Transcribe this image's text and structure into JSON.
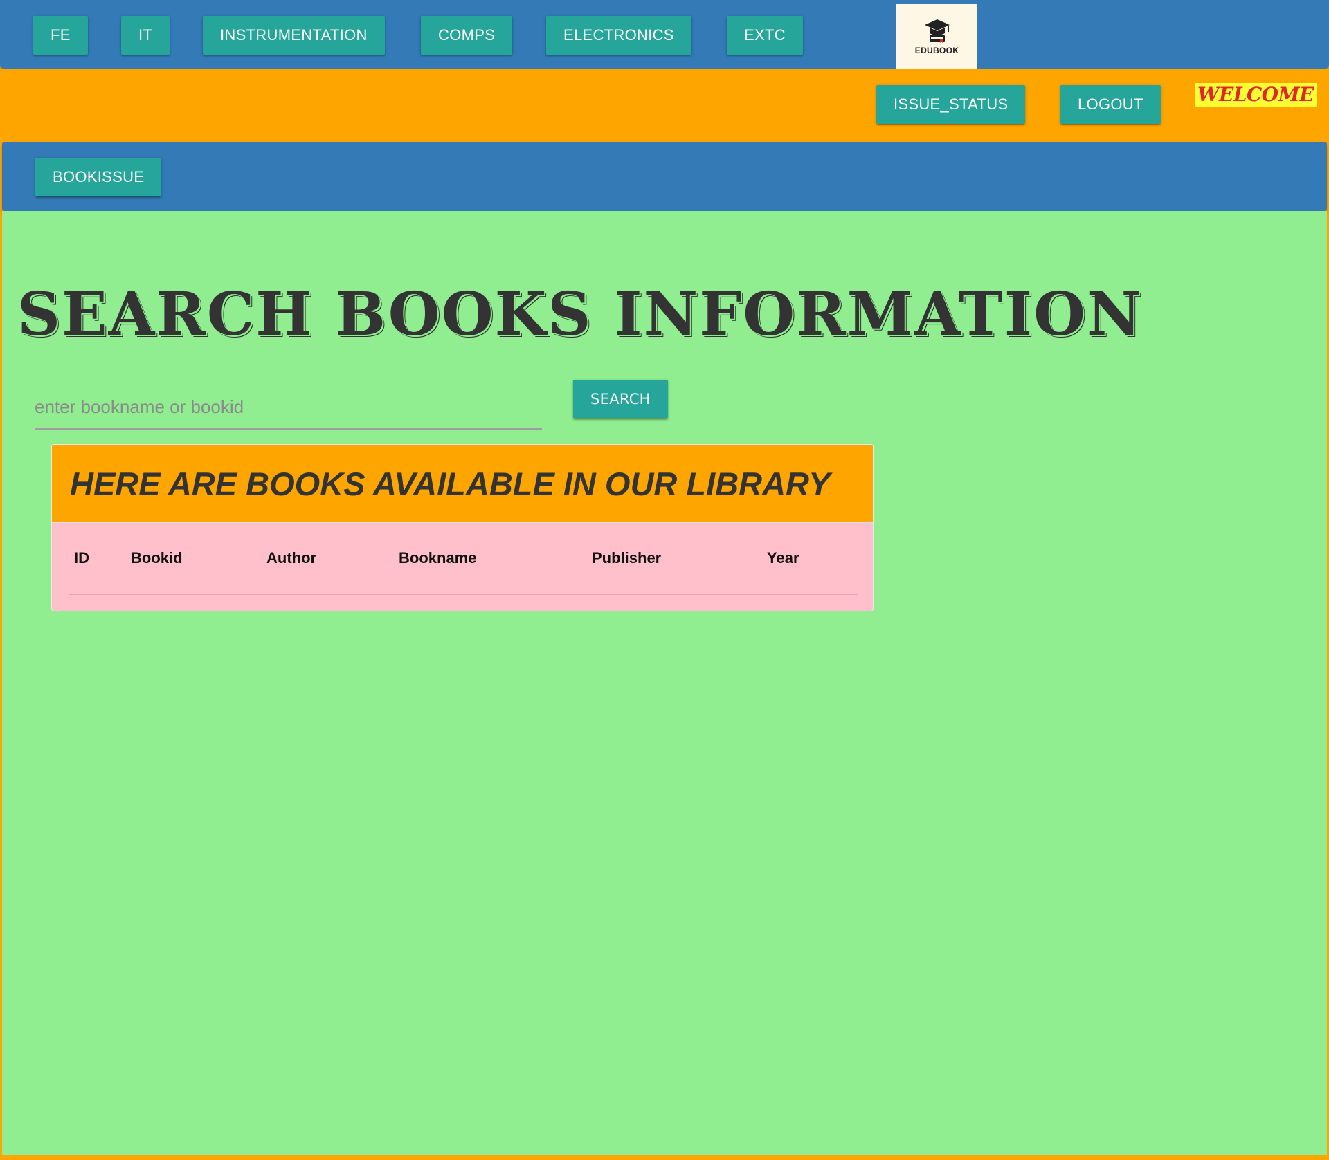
{
  "top_nav": {
    "items": [
      {
        "label": "FE"
      },
      {
        "label": "IT"
      },
      {
        "label": "INSTRUMENTATION"
      },
      {
        "label": "COMPS"
      },
      {
        "label": "ELECTRONICS"
      },
      {
        "label": "EXTC"
      }
    ],
    "logo": {
      "text": "EDUBOOK",
      "icon": "graduation-cap-book-icon"
    }
  },
  "user_bar": {
    "issue_status_label": "ISSUE_STATUS",
    "logout_label": "LOGOUT",
    "welcome_text": "WELCOME"
  },
  "secondary_nav": {
    "bookissue_label": "BOOKISSUE"
  },
  "main": {
    "title": "SEARCH BOOKS INFORMATION",
    "search": {
      "placeholder": "enter bookname or bookid",
      "value": "",
      "button_label": "SEARCH"
    },
    "library_card": {
      "heading": "HERE ARE BOOKS AVAILABLE IN OUR LIBRARY",
      "columns": [
        "ID",
        "Bookid",
        "Author",
        "Bookname",
        "Publisher",
        "Year"
      ],
      "rows": []
    }
  },
  "colors": {
    "nav_blue": "#337ab7",
    "accent_orange": "#ffa500",
    "button_teal": "#26a69a",
    "content_green": "#90ee90",
    "table_pink": "#ffc0cb",
    "welcome_red": "#e3242b",
    "welcome_yellow": "#ffff33"
  }
}
